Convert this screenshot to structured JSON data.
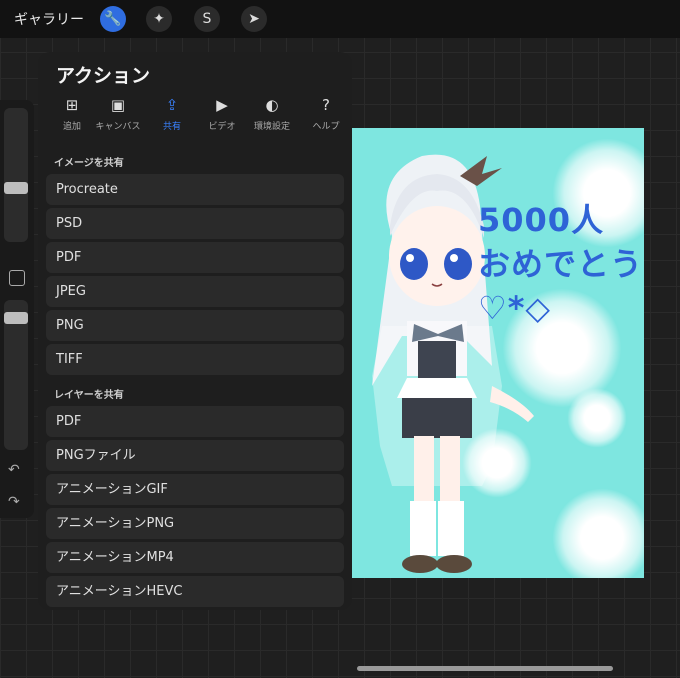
{
  "toolbar": {
    "gallery_label": "ギャラリー",
    "tools": [
      {
        "name": "wrench-icon",
        "glyph": "🔧"
      },
      {
        "name": "magic-wand-icon",
        "glyph": "✦"
      },
      {
        "name": "selection-icon",
        "glyph": "S"
      },
      {
        "name": "transform-arrow-icon",
        "glyph": "➤"
      }
    ]
  },
  "panel": {
    "title": "アクション",
    "tabs": [
      {
        "label": "追加",
        "icon": "add-icon"
      },
      {
        "label": "キャンバス",
        "icon": "canvas-icon"
      },
      {
        "label": "共有",
        "icon": "share-icon"
      },
      {
        "label": "ビデオ",
        "icon": "video-icon"
      },
      {
        "label": "環境設定",
        "icon": "preferences-icon"
      },
      {
        "label": "ヘルプ",
        "icon": "help-icon"
      }
    ],
    "share_image_label": "イメージを共有",
    "share_image_items": [
      "Procreate",
      "PSD",
      "PDF",
      "JPEG",
      "PNG",
      "TIFF"
    ],
    "share_layers_label": "レイヤーを共有",
    "share_layers_items": [
      "PDF",
      "PNGファイル",
      "アニメーションGIF",
      "アニメーションPNG",
      "アニメーションMP4",
      "アニメーションHEVC"
    ]
  },
  "canvas": {
    "text_line1": "5000人",
    "text_line2": "おめでとう",
    "text_line3": "♡*◇",
    "accent": "#2e63d6",
    "background": "#7ee6e0"
  },
  "colors": {
    "active_tool": "#2f6de0",
    "active_tab": "#3a82ff"
  }
}
